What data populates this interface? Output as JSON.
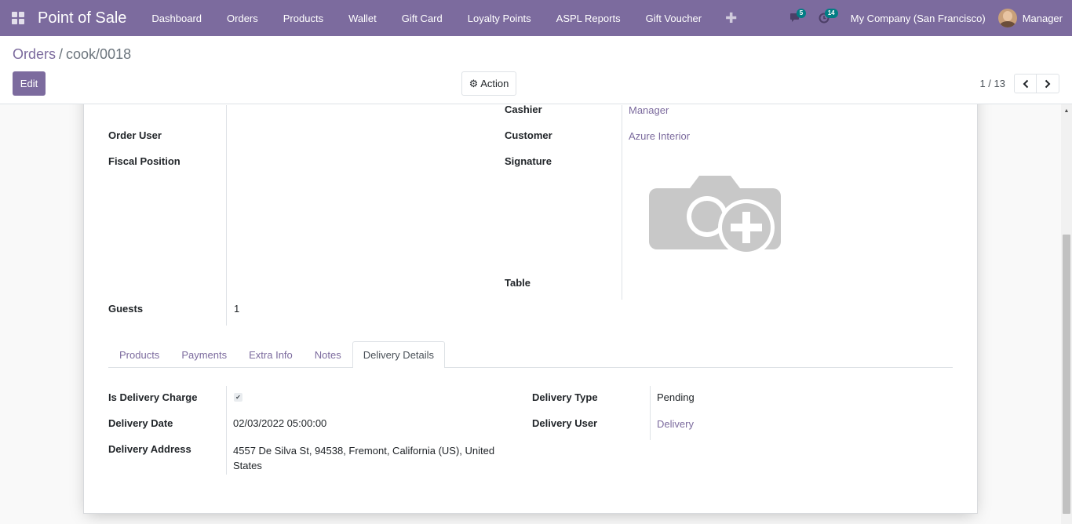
{
  "navbar": {
    "brand": "Point of Sale",
    "menu": [
      "Dashboard",
      "Orders",
      "Products",
      "Wallet",
      "Gift Card",
      "Loyalty Points",
      "ASPL Reports",
      "Gift Voucher"
    ],
    "messages_count": "5",
    "activities_count": "14",
    "company": "My Company (San Francisco)",
    "user": "Manager",
    "accent": "#7c6b9e"
  },
  "breadcrumb": {
    "parent": "Orders",
    "separator": "/",
    "current": "cook/0018"
  },
  "toolbar": {
    "edit_label": "Edit",
    "action_label": "Action",
    "pager_value": "1 / 13"
  },
  "form": {
    "cashier_label": "Cashier",
    "cashier_value": "Manager",
    "order_user_label": "Order User",
    "customer_label": "Customer",
    "customer_value": "Azure Interior",
    "fiscal_position_label": "Fiscal Position",
    "signature_label": "Signature",
    "table_label": "Table",
    "guests_label": "Guests",
    "guests_value": "1"
  },
  "tabs": [
    "Products",
    "Payments",
    "Extra Info",
    "Notes",
    "Delivery Details"
  ],
  "active_tab": "Delivery Details",
  "delivery": {
    "is_delivery_charge_label": "Is Delivery Charge",
    "is_delivery_charge": true,
    "delivery_date_label": "Delivery Date",
    "delivery_date_value": "02/03/2022 05:00:00",
    "delivery_address_label": "Delivery Address",
    "delivery_address_line1": "4557 De Silva St, 94538, Fremont, California (US), United",
    "delivery_address_line2": "States",
    "delivery_type_label": "Delivery Type",
    "delivery_type_value": "Pending",
    "delivery_user_label": "Delivery User",
    "delivery_user_value": "Delivery"
  }
}
